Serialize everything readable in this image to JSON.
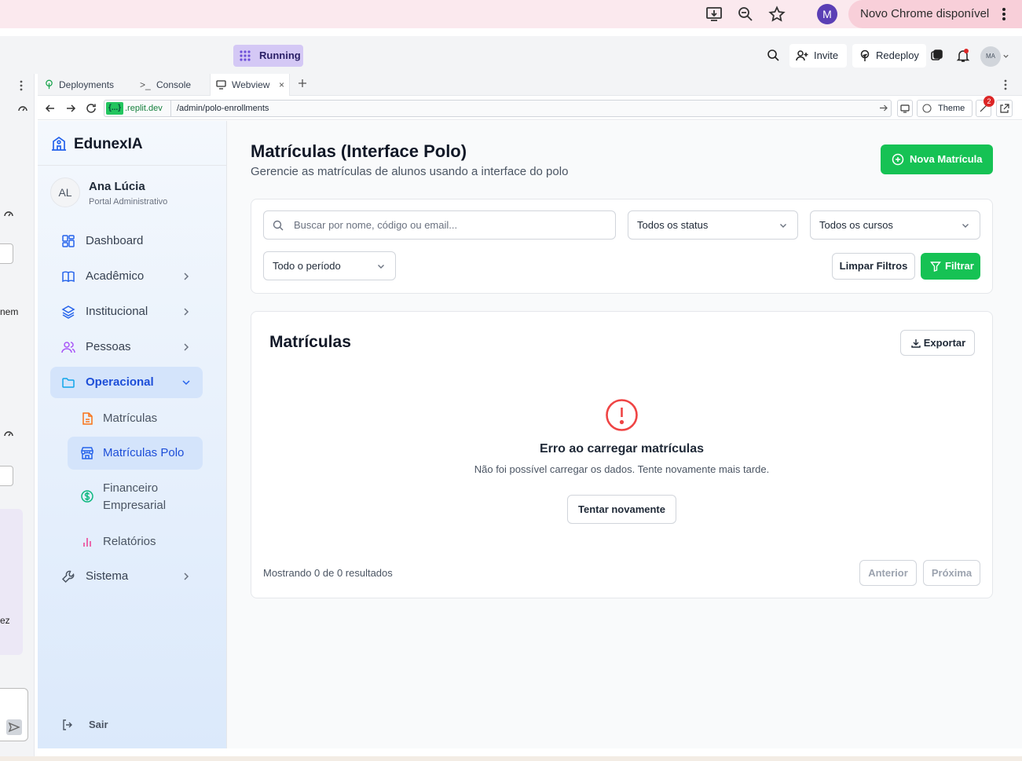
{
  "browser": {
    "update_label": "Novo Chrome disponível",
    "profile_initial": "M",
    "icons": [
      "install-icon",
      "zoom-icon",
      "star-icon",
      "menu-dots-icon"
    ]
  },
  "replit": {
    "status": "Running",
    "invite_label": "Invite",
    "redeploy_label": "Redeploy",
    "avatar_initials": "MA",
    "tabs": [
      {
        "label": "Deployments"
      },
      {
        "label": "Console"
      },
      {
        "label": "Webview"
      }
    ],
    "url_domain_tag": "{...}",
    "url_domain": ".replit.dev",
    "url_path": "/admin/polo-enrollments",
    "theme_label": "Theme",
    "notification_count": "2",
    "left_fragments": [
      "nem",
      "ez"
    ]
  },
  "sidebar": {
    "brand": "EdunexIA",
    "user_initials": "AL",
    "user_name": "Ana Lúcia",
    "user_role": "Portal Administrativo",
    "items": [
      {
        "label": "Dashboard"
      },
      {
        "label": "Acadêmico"
      },
      {
        "label": "Institucional"
      },
      {
        "label": "Pessoas"
      },
      {
        "label": "Operacional"
      },
      {
        "label": "Sistema"
      }
    ],
    "sub_items": [
      {
        "label": "Matrículas"
      },
      {
        "label": "Matrículas Polo"
      },
      {
        "label_line1": "Financeiro",
        "label_line2": "Empresarial"
      },
      {
        "label": "Relatórios"
      }
    ],
    "logout_label": "Sair"
  },
  "main": {
    "title": "Matrículas (Interface Polo)",
    "subtitle": "Gerencie as matrículas de alunos usando a interface do polo",
    "new_button": "Nova Matrícula",
    "filters": {
      "search_placeholder": "Buscar por nome, código ou email...",
      "status_value": "Todos os status",
      "course_value": "Todos os cursos",
      "period_value": "Todo o período",
      "clear_label": "Limpar Filtros",
      "filter_label": "Filtrar"
    },
    "list": {
      "title": "Matrículas",
      "export_label": "Exportar",
      "error_title": "Erro ao carregar matrículas",
      "error_message": "Não foi possível carregar os dados. Tente novamente mais tarde.",
      "retry_label": "Tentar novamente",
      "results_text": "Mostrando 0 de 0 resultados",
      "prev_label": "Anterior",
      "next_label": "Próxima"
    }
  },
  "colors": {
    "primary_green": "#16c254",
    "active_blue": "#2563eb",
    "error_red": "#ef4444"
  }
}
